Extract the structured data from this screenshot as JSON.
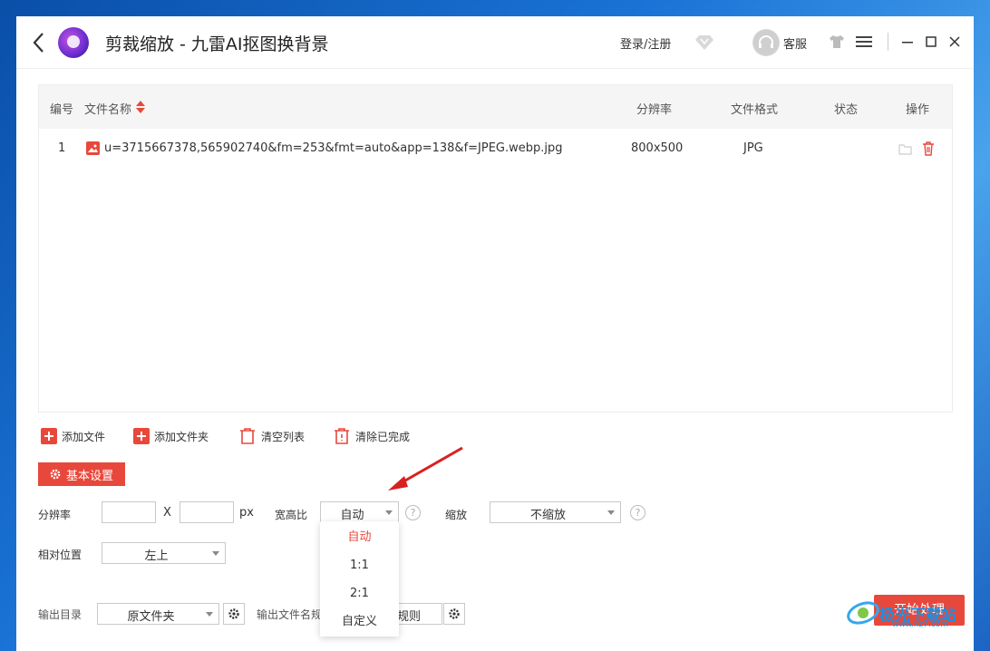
{
  "app": {
    "title": "剪裁缩放 - 九雷AI抠图换背景",
    "login_label": "登录/注册",
    "service_label": "客服"
  },
  "table": {
    "headers": {
      "index": "编号",
      "filename": "文件名称",
      "resolution": "分辨率",
      "format": "文件格式",
      "status": "状态",
      "actions": "操作"
    },
    "rows": [
      {
        "index": "1",
        "filename": "u=3715667378,565902740&fm=253&fmt=auto&app=138&f=JPEG.webp.jpg",
        "resolution": "800x500",
        "format": "JPG",
        "status": ""
      }
    ]
  },
  "toolbar": {
    "add_file": "添加文件",
    "add_folder": "添加文件夹",
    "clear_list": "清空列表",
    "clear_done": "清除已完成"
  },
  "settings": {
    "section_label": "基本设置",
    "resolution_label": "分辨率",
    "width_value": "",
    "x_label": "X",
    "height_value": "",
    "px_label": "px",
    "aspect_label": "宽高比",
    "aspect_value": "自动",
    "scale_label": "缩放",
    "scale_value": "不缩放",
    "position_label": "相对位置",
    "position_value": "左上",
    "output_dir_label": "输出目录",
    "output_dir_value": "原文件夹",
    "output_name_label": "输出文件名规",
    "output_name_value": "规则"
  },
  "aspect_dropdown": {
    "options": [
      "自动",
      "1:1",
      "2:1",
      "自定义"
    ],
    "selected_index": 0
  },
  "start_button": "开始处理",
  "watermark": {
    "text": "极光下载站",
    "sub": "www.xz7.com"
  },
  "colors": {
    "accent": "#e8483b",
    "header_bg": "#f6f5f5",
    "arrow": "#d92020"
  }
}
